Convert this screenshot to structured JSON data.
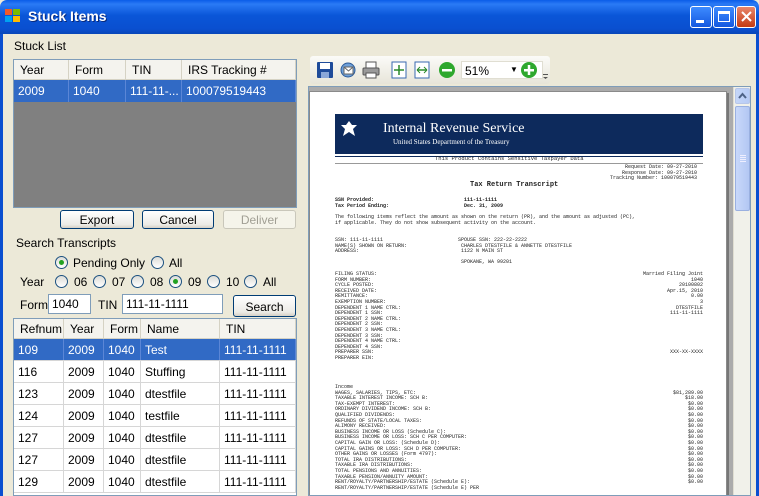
{
  "window": {
    "title": "Stuck Items"
  },
  "stuck_list": {
    "label": "Stuck List",
    "columns": [
      "Year",
      "Form",
      "TIN",
      "IRS Tracking #"
    ],
    "rows": [
      {
        "year": "2009",
        "form": "1040",
        "tin": "111-11-...",
        "tracking": "100079519443",
        "selected": true
      }
    ]
  },
  "actions": {
    "export": "Export",
    "cancel": "Cancel",
    "deliver": "Deliver"
  },
  "search": {
    "label": "Search Transcripts",
    "pending_only": "Pending Only",
    "all": "All",
    "year_label": "Year",
    "year_options": [
      "06",
      "07",
      "08",
      "09",
      "10",
      "All"
    ],
    "selected_year": "09",
    "form_label": "Form",
    "form_value": "1040",
    "tin_label": "TIN",
    "tin_value": "111-11-1111",
    "search_button": "Search"
  },
  "results": {
    "columns": [
      "Refnum",
      "Year",
      "Form",
      "Name",
      "TIN"
    ],
    "rows": [
      {
        "refnum": "109",
        "year": "2009",
        "form": "1040",
        "name": "Test",
        "tin": "111-11-1111",
        "selected": true
      },
      {
        "refnum": "116",
        "year": "2009",
        "form": "1040",
        "name": "Stuffing",
        "tin": "111-11-1111"
      },
      {
        "refnum": "123",
        "year": "2009",
        "form": "1040",
        "name": "dtestfile",
        "tin": "111-11-1111"
      },
      {
        "refnum": "124",
        "year": "2009",
        "form": "1040",
        "name": "testfile",
        "tin": "111-11-1111"
      },
      {
        "refnum": "127",
        "year": "2009",
        "form": "1040",
        "name": "dtestfile",
        "tin": "111-11-1111"
      },
      {
        "refnum": "127",
        "year": "2009",
        "form": "1040",
        "name": "dtestfile",
        "tin": "111-11-1111"
      },
      {
        "refnum": "129",
        "year": "2009",
        "form": "1040",
        "name": "dtestfile",
        "tin": "111-11-1111"
      }
    ]
  },
  "toolbar": {
    "zoom": "51%"
  },
  "document": {
    "irs_title": "Internal Revenue Service",
    "irs_subtitle": "United States Department of the Treasury",
    "sensitive": "This Product Contains Sensitive Taxpayer Data",
    "dates": "Request Date: 09-27-2010\n Response Date: 09-27-2010\nTracking Number: 100079519443",
    "heading": "Tax Return Transcript",
    "ssn_block": "SSN Provided:                              111-11-1111\nTax Period Ending:                         Dec. 31, 2009",
    "intro": "The following items reflect the amount as shown on the return (PR), and the amount as adjusted (PC),\nif applicable. They do not show subsequent activity on the account.",
    "taxpayer": "SSN: 111-11-1111                         SPOUSE SSN: 222-22-2222\nNAME(S) SHOWN ON RETURN:                  CHARLES DTESTFILE & ANNETTE DTESTFILE\nADDRESS:                                  1122 N MAIN ST\n\n                                          SPOKANE, WA 99201",
    "filing_labels": "FILING STATUS:\nFORM NUMBER:\nCYCLE POSTED:\nRECEIVED DATE:\nREMITTANCE:\nEXEMPTION NUMBER:\nDEPENDENT 1 NAME CTRL:\nDEPENDENT 1 SSN:\nDEPENDENT 2 NAME CTRL:\nDEPENDENT 2 SSN:\nDEPENDENT 3 NAME CTRL:\nDEPENDENT 3 SSN:\nDEPENDENT 4 NAME CTRL:\nDEPENDENT 4 SSN:\nPREPARER SSN:\nPREPARER EIN:",
    "filing_values": "Married Filing Joint\n1040\n20100802\nApr.15, 2010\n0.00\n3\nDTESTFILE\n111-11-1111\n\n\n\n\n\n\nXXX-XX-XXXX\n",
    "income_labels": "Income\nWAGES, SALARIES, TIPS, ETC:\nTAXABLE INTEREST INCOME: SCH B:\nTAX-EXEMPT INTEREST:\nORDINARY DIVIDEND INCOME: SCH B:\nQUALIFIED DIVIDENDS:\nREFUNDS OF STATE/LOCAL TAXES:\nALIMONY RECEIVED:\nBUSINESS INCOME OR LOSS (Schedule C):\nBUSINESS INCOME OR LOSS: SCH C PER COMPUTER:\nCAPITAL GAIN OR LOSS: (Schedule D):\nCAPITAL GAINS OR LOSS: SCH D PER COMPUTER:\nOTHER GAINS OR LOSSES (Form 4797):\nTOTAL IRA DISTRIBUTIONS:\nTAXABLE IRA DISTRIBUTIONS:\nTOTAL PENSIONS AND ANNUITIES:\nTAXABLE PENSION/ANNUITY AMOUNT:\nRENT/ROYALTY/PARTNERSHIP/ESTATE (Schedule E):\nRENT/ROYALTY/PARTNERSHIP/ESTATE (Schedule E) PER",
    "income_values": "\n$81,289.00\n$18.00\n$0.00\n$0.00\n$0.00\n$0.00\n$0.00\n$0.00\n$0.00\n$0.00\n$0.00\n$0.00\n$0.00\n$0.00\n$0.00\n$0.00\n$0.00\n"
  }
}
